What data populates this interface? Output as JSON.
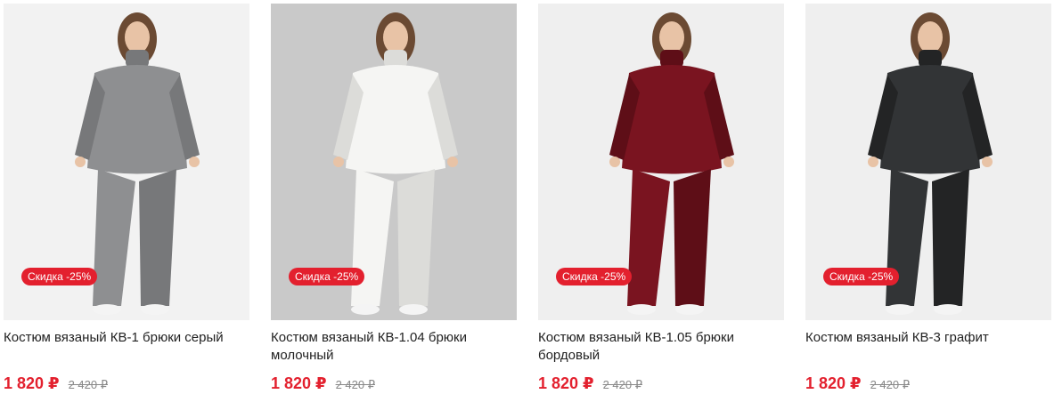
{
  "products": [
    {
      "image": "woman-in-grey-knit-suit-photo",
      "badge": "Скидка -25%",
      "title": "Костюм вязаный КВ-1 брюки серый",
      "price": "1 820 ₽",
      "old_price": "2 420 ₽",
      "colors": {
        "bg": "#f2f2f2",
        "garment": "#8e8f91",
        "garment_dark": "#77787a"
      }
    },
    {
      "image": "woman-in-white-knit-suit-photo",
      "badge": "Скидка -25%",
      "title": "Костюм вязаный КВ-1.04 брюки молочный",
      "price": "1 820 ₽",
      "old_price": "2 420 ₽",
      "colors": {
        "bg": "#c9c9c9",
        "garment": "#f5f5f3",
        "garment_dark": "#dcdcd9"
      }
    },
    {
      "image": "woman-in-burgundy-knit-suit-photo",
      "badge": "Скидка -25%",
      "title": "Костюм вязаный КВ-1.05 брюки бордовый",
      "price": "1 820 ₽",
      "old_price": "2 420 ₽",
      "colors": {
        "bg": "#efefef",
        "garment": "#7a1420",
        "garment_dark": "#5e0e17"
      }
    },
    {
      "image": "woman-in-graphite-knit-suit-photo",
      "badge": "Скидка -25%",
      "title": "Костюм вязаный КВ-3 графит",
      "price": "1 820 ₽",
      "old_price": "2 420 ₽",
      "colors": {
        "bg": "#efefef",
        "garment": "#323436",
        "garment_dark": "#232425"
      }
    }
  ],
  "accent_color": "#e3202e"
}
